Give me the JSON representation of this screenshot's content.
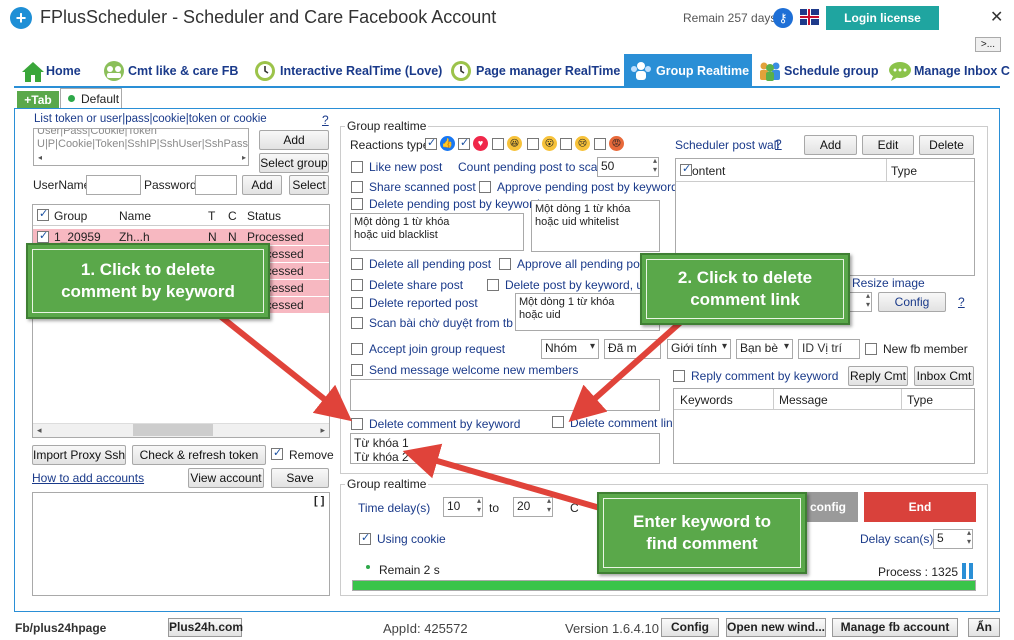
{
  "titlebar": {
    "app_title": "FPlusScheduler - Scheduler and Care Facebook Account",
    "remain_days": "Remain 257 days",
    "login_label": "Login license",
    "close_glyph": "✕",
    "more_label": ">..."
  },
  "nav": {
    "tabs": [
      {
        "label": "Home",
        "icon": "house-icon"
      },
      {
        "label": "Cmt like & care FB",
        "icon": "users-icon"
      },
      {
        "label": "Interactive RealTime (Love)",
        "icon": "clock-icon"
      },
      {
        "label": "Page manager RealTime",
        "icon": "clock-icon"
      },
      {
        "label": "Group Realtime",
        "icon": "group-icon"
      },
      {
        "label": "Schedule group",
        "icon": "people-icon"
      },
      {
        "label": "Manage Inbox C",
        "icon": "chat-icon"
      }
    ],
    "active_tab": "Group Realtime",
    "subtabs": {
      "add": "+Tab",
      "default": "Default"
    }
  },
  "left": {
    "token_label": "List token or user|pass|cookie|token or cookie",
    "help": "?",
    "token_placeholder_line1": "User|Pass|Cookie|Token",
    "token_placeholder_line2": "U|P|Cookie|Token|SshIP|SshUser|SshPass",
    "add_btn": "Add",
    "select_group_btn": "Select group",
    "username_label": "UserName",
    "password_label": "Password",
    "add_btn2": "Add",
    "select_btn": "Select",
    "table_headers": [
      "Group",
      "Name",
      "T",
      "C",
      "Status"
    ],
    "rows": [
      {
        "group": "1_20959",
        "name": "Zh...h",
        "t": "N",
        "c": "N",
        "status": "Processed"
      },
      {
        "group": "",
        "name": "",
        "t": "",
        "c": "",
        "status": "Processed"
      },
      {
        "group": "",
        "name": "",
        "t": "",
        "c": "",
        "status": "Processed"
      },
      {
        "group": "",
        "name": "",
        "t": "",
        "c": "",
        "status": "Processed"
      },
      {
        "group": "",
        "name": "",
        "t": "",
        "c": "",
        "status": "Processed"
      }
    ],
    "import_proxy_btn": "Import Proxy Ssh",
    "check_token_btn": "Check & refresh token",
    "remove_label": "Remove",
    "how_to_link": "How to add accounts",
    "view_account_btn": "View account",
    "save_btn": "Save",
    "log_corner": "[ ]"
  },
  "group_realtime": {
    "title": "Group realtime",
    "reactions_label": "Reactions type:",
    "like_new_post": "Like new post",
    "count_pending_label": "Count pending post to scan",
    "count_pending_value": "50",
    "share_scanned_post": "Share scanned post",
    "approve_pending_by_keyword": "Approve pending post by keyword",
    "delete_pending_by_keyword": "Delete pending post by keyword",
    "blacklist_text": "Một dòng 1 từ khóa\nhoặc uid blacklist",
    "whitelist_text": "Một dòng 1 từ khóa\nhoặc uid whitelist",
    "delete_all_pending": "Delete all pending post",
    "approve_all_pending": "Approve all pending post",
    "delete_share_post": "Delete share post",
    "delete_post_by_keyword": "Delete post by keyword, uid",
    "delete_reported_post": "Delete reported post",
    "scan_pending_posts": "Scan bài chờ duyệt from tb",
    "keyword_uid_text": "Một dòng 1 từ khóa\nhoặc uid",
    "accept_join_request": "Accept join group request",
    "filter_group": "Nhóm",
    "filter_answered": "Đã m",
    "filter_gender": "Giới tính",
    "filter_friend": "Bạn bè",
    "filter_location_placeholder": "ID Vị trí",
    "new_fb_member": "New fb member",
    "send_welcome": "Send message welcome new members",
    "delete_comment_by_keyword": "Delete comment by keyword",
    "delete_comment_link": "Delete comment link",
    "comment_keywords": "Từ khóa 1\nTừ khóa 2"
  },
  "scheduler": {
    "label": "Scheduler post wall",
    "help": "?",
    "add_btn": "Add",
    "edit_btn": "Edit",
    "delete_btn": "Delete",
    "headers": [
      "ontent",
      "Type"
    ],
    "resize_image": "Resize image",
    "config_btn": "Config",
    "help2": "?"
  },
  "reply": {
    "label": "Reply comment by keyword",
    "reply_btn": "Reply Cmt",
    "inbox_btn": "Inbox Cmt",
    "headers": [
      "Keywords",
      "Message",
      "Type"
    ]
  },
  "bottom_group": {
    "title": "Group realtime",
    "time_delay_label": "Time delay(s)",
    "delay_from": "10",
    "to_label": "to",
    "delay_to": "20",
    "partial_c": "C",
    "save_config_partial": "e config",
    "end_btn": "End",
    "using_cookie": "Using cookie",
    "delay_scan_label": "Delay scan(s)",
    "delay_scan_value": "5",
    "remain": "Remain 2 s",
    "process": "Process : 1325",
    "progress_percent": 100
  },
  "callouts": {
    "c1": "1. Click to delete comment by keyword",
    "c2": "2. Click to delete comment link",
    "c3": "Enter keyword to find comment"
  },
  "statusbar": {
    "fb": "Fb/plus24hpage",
    "site_btn": "Plus24h.com",
    "appid": "AppId: 425572",
    "version": "Version 1.6.4.10",
    "config_btn": "Config",
    "open_new_btn": "Open new wind...",
    "manage_btn": "Manage fb account",
    "lang_btn": "Ẩn"
  },
  "colors": {
    "accent": "#1fa5a0",
    "nav_active": "#2a8fd6",
    "callout_green": "#5aa84a",
    "arrow_red": "#e0433a",
    "end_red": "#d9413b",
    "progress_green": "#39c44a"
  }
}
